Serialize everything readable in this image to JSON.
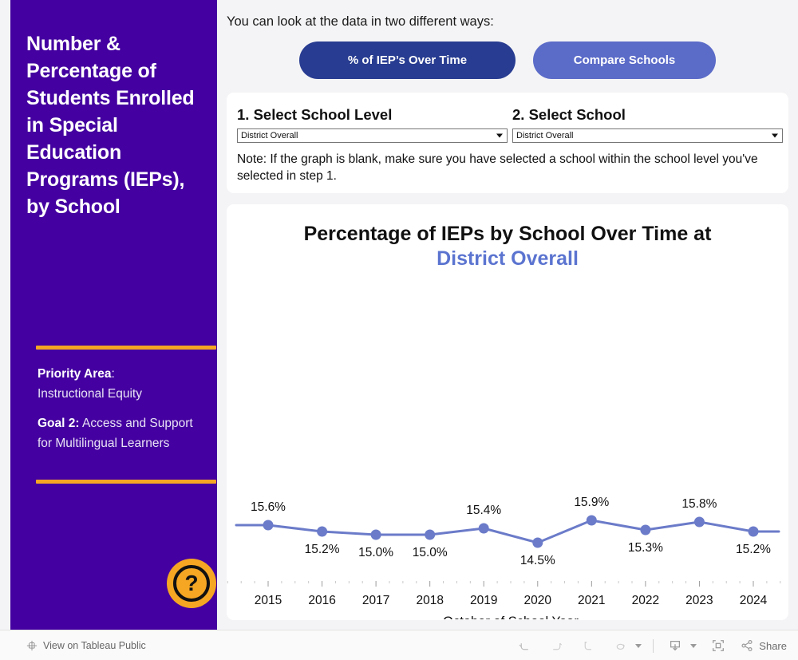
{
  "sidebar": {
    "title": "Number & Percentage of Students Enrolled in Special Education Programs (IEPs), by School",
    "priority_label": "Priority Area",
    "priority_sep": ":",
    "priority_value": "Instructional Equity",
    "goal_label": "Goal 2:",
    "goal_value": " Access and Support for Multilingual Learners",
    "help_icon_glyph": "?",
    "gold_color": "#f5a623",
    "background_color": "#4400a0"
  },
  "main": {
    "intro_text": "You can look at the data in two different ways:",
    "tabs": [
      {
        "label": "% of IEP’s Over Time",
        "active": true,
        "color": "#283c91"
      },
      {
        "label": "Compare Schools",
        "active": false,
        "color": "#5b6bc8"
      }
    ]
  },
  "filters": {
    "step1_label": "1. Select School Level",
    "step1_value": "District Overall",
    "step2_label": "2. Select School",
    "step2_value": "District Overall",
    "note": "Note: If the graph is blank, make sure you have selected a school within the school level you've selected in step 1."
  },
  "chart_data": {
    "type": "line",
    "title_main": "Percentage of IEPs by School Over Time at",
    "title_accent": "District Overall",
    "xlabel": "October of School Year",
    "ylabel": "",
    "categories": [
      "2015",
      "2016",
      "2017",
      "2018",
      "2019",
      "2020",
      "2021",
      "2022",
      "2023",
      "2024"
    ],
    "values": [
      15.6,
      15.2,
      15.0,
      15.0,
      15.4,
      14.5,
      15.9,
      15.3,
      15.8,
      15.2
    ],
    "value_labels": [
      "15.6%",
      "15.2%",
      "15.0%",
      "15.0%",
      "15.4%",
      "14.5%",
      "15.9%",
      "15.3%",
      "15.8%",
      "15.2%"
    ],
    "label_positions": [
      "above",
      "below",
      "below",
      "below",
      "above",
      "below",
      "above",
      "below",
      "above",
      "below"
    ],
    "ylim": [
      0,
      20
    ],
    "grid": false,
    "legend": "none",
    "series_color": "#6b7bc9",
    "marker_color": "#6b7bc9"
  },
  "bottom_bar": {
    "tableau_label": "View on Tableau Public",
    "tableau_icon": "tableau-icon",
    "share_label": "Share",
    "tools": [
      {
        "name": "undo-button",
        "icon": "undo-icon"
      },
      {
        "name": "redo-button",
        "icon": "redo-icon"
      },
      {
        "name": "revert-button",
        "icon": "revert-icon"
      },
      {
        "name": "refresh-button",
        "icon": "refresh-icon"
      },
      {
        "name": "download-button",
        "icon": "download-icon"
      },
      {
        "name": "fullscreen-button",
        "icon": "fullscreen-icon"
      },
      {
        "name": "share-button",
        "icon": "share-icon"
      }
    ]
  }
}
